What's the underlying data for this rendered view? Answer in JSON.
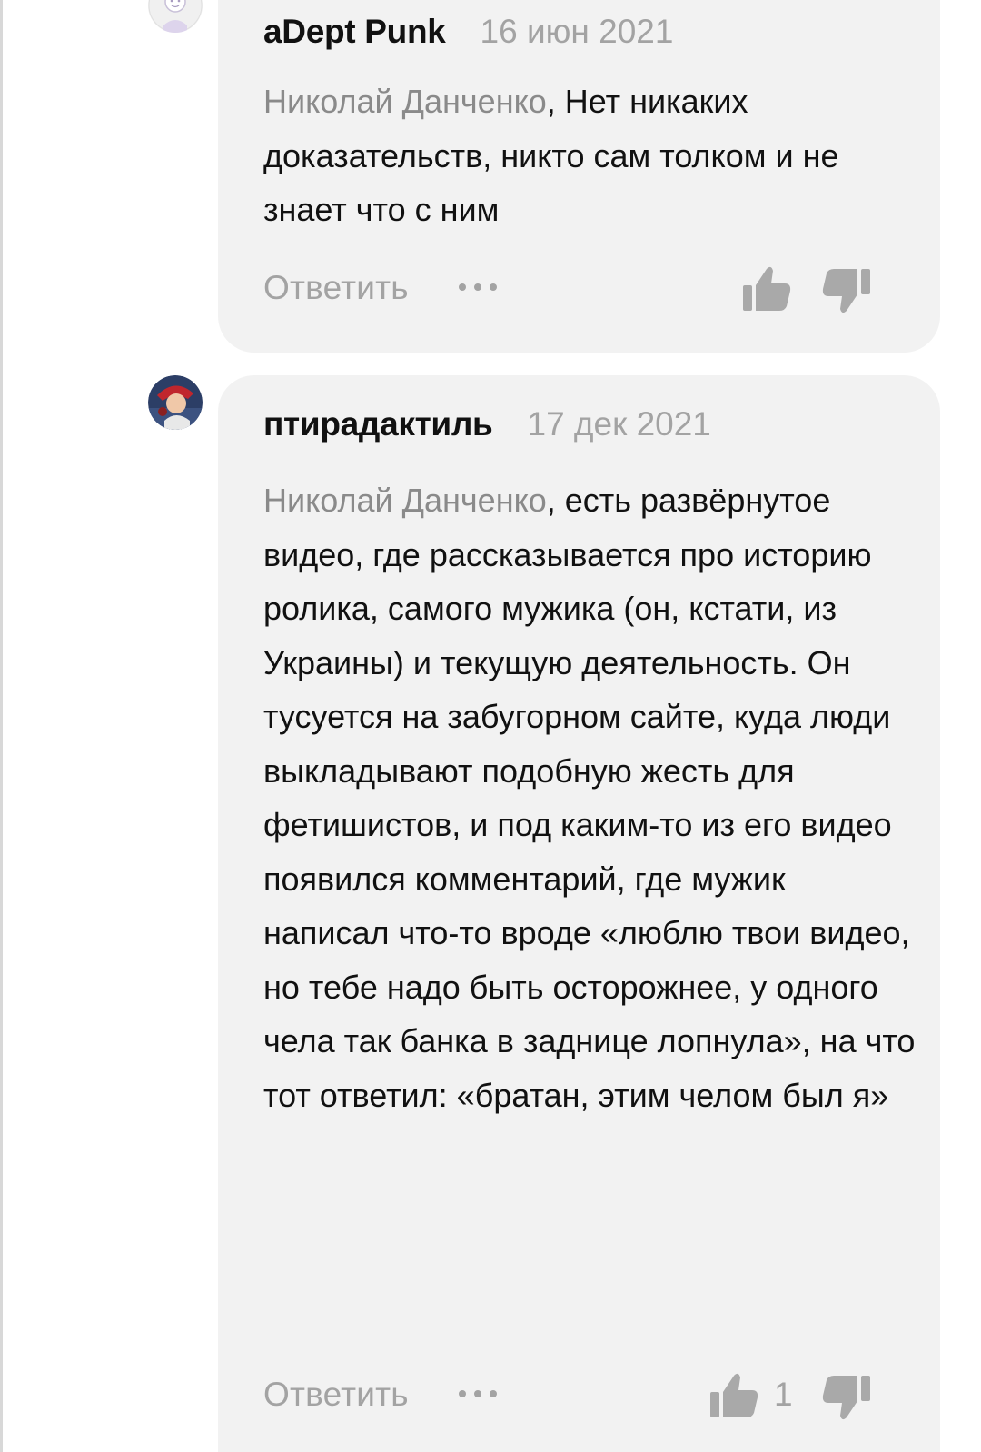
{
  "comments": [
    {
      "author": "aDept Punk",
      "date": "16 июн 2021",
      "mention": "Николай Данченко",
      "text": ", Нет никаких доказательств, никто сам толком и не знает что с ним",
      "reply_label": "Ответить",
      "likes": ""
    },
    {
      "author": "птирадактиль",
      "date": "17 дек 2021",
      "mention": "Николай Данченко",
      "text": ", есть развёрнутое видео, где рассказывается про историю ролика, самого мужика (он, кстати, из Украины) и текущую деятельность. Он тусуется на забугорном сайте, куда люди выкладывают подобную жесть для фетишистов, и под каким-то из его видео появился комментарий, где мужик написал что-то вроде «люблю твои видео, но тебе надо быть осторожнее, у одного чела так банка в заднице лопнула», на что тот ответил: «братан, этим челом был я»",
      "reply_label": "Ответить",
      "likes": "1"
    }
  ],
  "colors": {
    "bubble": "#f2f2f2",
    "muted": "#a3a3a3",
    "mention": "#8a8a8a",
    "text": "#111111"
  },
  "icons": [
    "default-avatar-icon",
    "user-avatar-image",
    "thumbs-up-icon",
    "thumbs-down-icon",
    "more-dots-icon"
  ]
}
